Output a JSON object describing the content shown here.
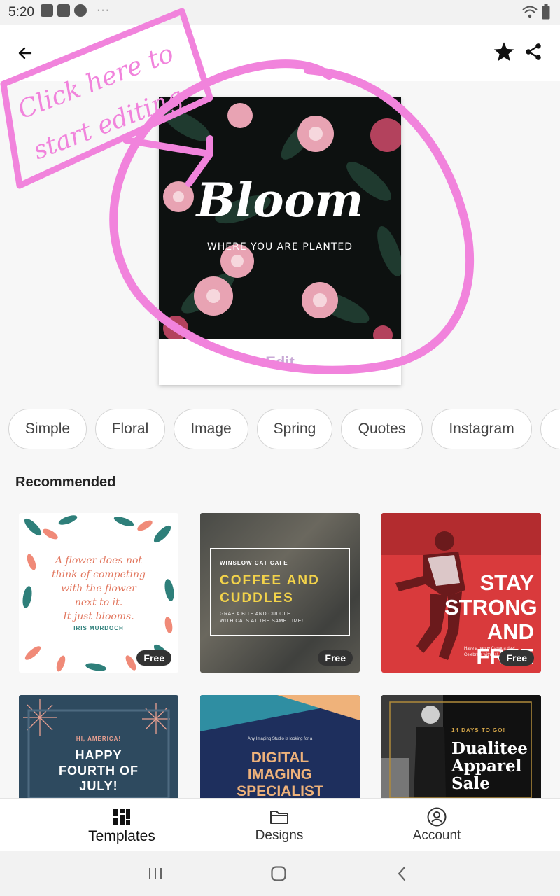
{
  "status_bar": {
    "time": "5:20",
    "icons": [
      "gallery-icon",
      "check-shield-icon",
      "download-icon",
      "more-dots-icon"
    ],
    "right_icons": [
      "wifi-icon",
      "battery-icon"
    ]
  },
  "header": {
    "back_icon": "arrow-left-icon",
    "favorite_icon": "star-icon",
    "share_icon": "share-icon"
  },
  "annotation": {
    "text_line1": "Click here to",
    "text_line2": "start editing",
    "color": "#f183dc"
  },
  "preview": {
    "title": "Bloom",
    "subtitle": "WHERE YOU ARE PLANTED",
    "edit_label": "Edit"
  },
  "chips": [
    "Simple",
    "Floral",
    "Image",
    "Spring",
    "Quotes",
    "Instagram"
  ],
  "recommended": {
    "title": "Recommended",
    "tiles": [
      {
        "lines": [
          "A flower does not",
          "think of competing",
          "with the flower",
          "next to it.",
          "It just blooms."
        ],
        "author": "IRIS MURDOCH",
        "badge": "Free"
      },
      {
        "kicker": "WINSLOW CAT CAFE",
        "headline": [
          "COFFEE AND",
          "CUDDLES"
        ],
        "body": [
          "GRAB A BITE AND CUDDLE",
          "WITH CATS AT THE SAME TIME!"
        ],
        "badge": "Free"
      },
      {
        "headline": [
          "STAY",
          "STRONG",
          "AND FREE"
        ],
        "small_text": "Have a happy Canada day! Celebrate with us!",
        "badge": "Free"
      },
      {
        "kicker": "HI, AMERICA!",
        "headline": [
          "HAPPY",
          "FOURTH OF",
          "JULY!"
        ]
      },
      {
        "kicker": "Any Imaging Studio is looking for a",
        "headline": [
          "DIGITAL",
          "IMAGING",
          "SPECIALIST"
        ]
      },
      {
        "kicker": "14 DAYS TO GO!",
        "headline": [
          "Dualitee",
          "Apparel",
          "Sale"
        ]
      }
    ]
  },
  "bottom_nav": {
    "items": [
      {
        "label": "Templates",
        "icon": "templates-grid-icon",
        "active": true
      },
      {
        "label": "Designs",
        "icon": "folder-icon",
        "active": false
      },
      {
        "label": "Account",
        "icon": "account-icon",
        "active": false
      }
    ]
  },
  "system_nav": {
    "icons": [
      "recent-apps-icon",
      "home-icon",
      "back-nav-icon"
    ]
  }
}
